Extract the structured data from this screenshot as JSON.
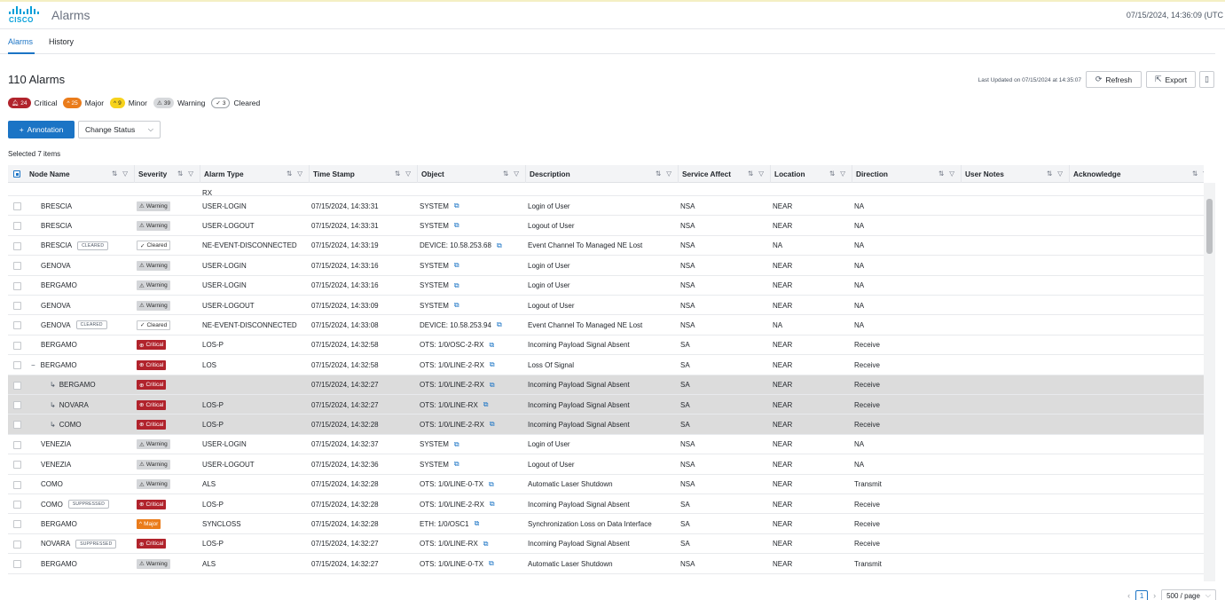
{
  "header": {
    "logo_text": "CISCO",
    "app_title": "Alarms",
    "datetime": "07/15/2024, 14:36:09 (UTC"
  },
  "tabs": [
    {
      "label": "Alarms",
      "active": true
    },
    {
      "label": "History",
      "active": false
    }
  ],
  "title": "110 Alarms",
  "last_updated": "Last Updated on 07/15/2024 at 14:35:07",
  "buttons": {
    "refresh": "Refresh",
    "export": "Export",
    "annotation": "Annotation",
    "change_status": "Change Status"
  },
  "summary": [
    {
      "count": "24",
      "label": "Critical",
      "kind": "crit",
      "icon": "bell-icon"
    },
    {
      "count": "25",
      "label": "Major",
      "kind": "maj",
      "icon": "chevron-up-icon"
    },
    {
      "count": "9",
      "label": "Minor",
      "kind": "min",
      "icon": "chevron-up-icon"
    },
    {
      "count": "39",
      "label": "Warning",
      "kind": "warn",
      "icon": "warning-icon"
    },
    {
      "count": "3",
      "label": "Cleared",
      "kind": "clr",
      "icon": "check-icon"
    }
  ],
  "selected_text": "Selected 7 items",
  "columns": [
    "Node Name",
    "Severity",
    "Alarm Type",
    "Time Stamp",
    "Object",
    "Description",
    "Service Affect",
    "Location",
    "Direction",
    "User Notes",
    "Acknowledge"
  ],
  "partial_top_row": {
    "alarm_type": "RX"
  },
  "rows": [
    {
      "node": "BRESCIA",
      "tag": "",
      "indent": "",
      "sev": "warn",
      "sev_label": "Warning",
      "type": "USER-LOGIN",
      "time": "07/15/2024, 14:33:31",
      "object": "SYSTEM",
      "desc": "Login of User",
      "sa": "NSA",
      "loc": "NEAR",
      "dir": "NA",
      "selected": false
    },
    {
      "node": "BRESCIA",
      "tag": "",
      "indent": "",
      "sev": "warn",
      "sev_label": "Warning",
      "type": "USER-LOGOUT",
      "time": "07/15/2024, 14:33:31",
      "object": "SYSTEM",
      "desc": "Logout of User",
      "sa": "NSA",
      "loc": "NEAR",
      "dir": "NA",
      "selected": false
    },
    {
      "node": "BRESCIA",
      "tag": "CLEARED",
      "indent": "",
      "sev": "clr",
      "sev_label": "Cleared",
      "type": "NE-EVENT-DISCONNECTED",
      "time": "07/15/2024, 14:33:19",
      "object": "DEVICE: 10.58.253.68",
      "desc": "Event Channel To Managed NE Lost",
      "sa": "NSA",
      "loc": "NA",
      "dir": "NA",
      "selected": false
    },
    {
      "node": "GENOVA",
      "tag": "",
      "indent": "",
      "sev": "warn",
      "sev_label": "Warning",
      "type": "USER-LOGIN",
      "time": "07/15/2024, 14:33:16",
      "object": "SYSTEM",
      "desc": "Login of User",
      "sa": "NSA",
      "loc": "NEAR",
      "dir": "NA",
      "selected": false
    },
    {
      "node": "BERGAMO",
      "tag": "",
      "indent": "",
      "sev": "warn",
      "sev_label": "Warning",
      "type": "USER-LOGIN",
      "time": "07/15/2024, 14:33:16",
      "object": "SYSTEM",
      "desc": "Login of User",
      "sa": "NSA",
      "loc": "NEAR",
      "dir": "NA",
      "selected": false
    },
    {
      "node": "GENOVA",
      "tag": "",
      "indent": "",
      "sev": "warn",
      "sev_label": "Warning",
      "type": "USER-LOGOUT",
      "time": "07/15/2024, 14:33:09",
      "object": "SYSTEM",
      "desc": "Logout of User",
      "sa": "NSA",
      "loc": "NEAR",
      "dir": "NA",
      "selected": false
    },
    {
      "node": "GENOVA",
      "tag": "CLEARED",
      "indent": "",
      "sev": "clr",
      "sev_label": "Cleared",
      "type": "NE-EVENT-DISCONNECTED",
      "time": "07/15/2024, 14:33:08",
      "object": "DEVICE: 10.58.253.94",
      "desc": "Event Channel To Managed NE Lost",
      "sa": "NSA",
      "loc": "NA",
      "dir": "NA",
      "selected": false
    },
    {
      "node": "BERGAMO",
      "tag": "",
      "indent": "",
      "sev": "crit",
      "sev_label": "Critical",
      "type": "LOS-P",
      "time": "07/15/2024, 14:32:58",
      "object": "OTS: 1/0/OSC-2-RX",
      "desc": "Incoming Payload Signal Absent",
      "sa": "SA",
      "loc": "NEAR",
      "dir": "Receive",
      "selected": false
    },
    {
      "node": "BERGAMO",
      "tag": "",
      "indent": "parent",
      "sev": "crit",
      "sev_label": "Critical",
      "type": "LOS",
      "time": "07/15/2024, 14:32:58",
      "object": "OTS: 1/0/LINE-2-RX",
      "desc": "Loss Of Signal",
      "sa": "SA",
      "loc": "NEAR",
      "dir": "Receive",
      "selected": false
    },
    {
      "node": "BERGAMO",
      "tag": "",
      "indent": "child",
      "sev": "crit",
      "sev_label": "Critical",
      "type": "",
      "time": "07/15/2024, 14:32:27",
      "object": "OTS: 1/0/LINE-2-RX",
      "desc": "Incoming Payload Signal Absent",
      "sa": "SA",
      "loc": "NEAR",
      "dir": "Receive",
      "selected": true
    },
    {
      "node": "NOVARA",
      "tag": "",
      "indent": "child",
      "sev": "crit",
      "sev_label": "Critical",
      "type": "LOS-P",
      "time": "07/15/2024, 14:32:27",
      "object": "OTS: 1/0/LINE-RX",
      "desc": "Incoming Payload Signal Absent",
      "sa": "SA",
      "loc": "NEAR",
      "dir": "Receive",
      "selected": true
    },
    {
      "node": "COMO",
      "tag": "",
      "indent": "child",
      "sev": "crit",
      "sev_label": "Critical",
      "type": "LOS-P",
      "time": "07/15/2024, 14:32:28",
      "object": "OTS: 1/0/LINE-2-RX",
      "desc": "Incoming Payload Signal Absent",
      "sa": "SA",
      "loc": "NEAR",
      "dir": "Receive",
      "selected": true
    },
    {
      "node": "VENEZIA",
      "tag": "",
      "indent": "",
      "sev": "warn",
      "sev_label": "Warning",
      "type": "USER-LOGIN",
      "time": "07/15/2024, 14:32:37",
      "object": "SYSTEM",
      "desc": "Login of User",
      "sa": "NSA",
      "loc": "NEAR",
      "dir": "NA",
      "selected": false
    },
    {
      "node": "VENEZIA",
      "tag": "",
      "indent": "",
      "sev": "warn",
      "sev_label": "Warning",
      "type": "USER-LOGOUT",
      "time": "07/15/2024, 14:32:36",
      "object": "SYSTEM",
      "desc": "Logout of User",
      "sa": "NSA",
      "loc": "NEAR",
      "dir": "NA",
      "selected": false
    },
    {
      "node": "COMO",
      "tag": "",
      "indent": "",
      "sev": "warn",
      "sev_label": "Warning",
      "type": "ALS",
      "time": "07/15/2024, 14:32:28",
      "object": "OTS: 1/0/LINE-0-TX",
      "desc": "Automatic Laser Shutdown",
      "sa": "NSA",
      "loc": "NEAR",
      "dir": "Transmit",
      "selected": false
    },
    {
      "node": "COMO",
      "tag": "SUPPRESSED",
      "indent": "",
      "sev": "crit",
      "sev_label": "Critical",
      "type": "LOS-P",
      "time": "07/15/2024, 14:32:28",
      "object": "OTS: 1/0/LINE-2-RX",
      "desc": "Incoming Payload Signal Absent",
      "sa": "SA",
      "loc": "NEAR",
      "dir": "Receive",
      "selected": false
    },
    {
      "node": "BERGAMO",
      "tag": "",
      "indent": "",
      "sev": "maj",
      "sev_label": "Major",
      "type": "SYNCLOSS",
      "time": "07/15/2024, 14:32:28",
      "object": "ETH: 1/0/OSC1",
      "desc": "Synchronization Loss on Data Interface",
      "sa": "SA",
      "loc": "NEAR",
      "dir": "Receive",
      "selected": false
    },
    {
      "node": "NOVARA",
      "tag": "SUPPRESSED",
      "indent": "",
      "sev": "crit",
      "sev_label": "Critical",
      "type": "LOS-P",
      "time": "07/15/2024, 14:32:27",
      "object": "OTS: 1/0/LINE-RX",
      "desc": "Incoming Payload Signal Absent",
      "sa": "SA",
      "loc": "NEAR",
      "dir": "Receive",
      "selected": false
    },
    {
      "node": "BERGAMO",
      "tag": "",
      "indent": "",
      "sev": "warn",
      "sev_label": "Warning",
      "type": "ALS",
      "time": "07/15/2024, 14:32:27",
      "object": "OTS: 1/0/LINE-0-TX",
      "desc": "Automatic Laser Shutdown",
      "sa": "NSA",
      "loc": "NEAR",
      "dir": "Transmit",
      "selected": false
    }
  ],
  "pagination": {
    "page": "1",
    "page_size": "500 / page"
  }
}
